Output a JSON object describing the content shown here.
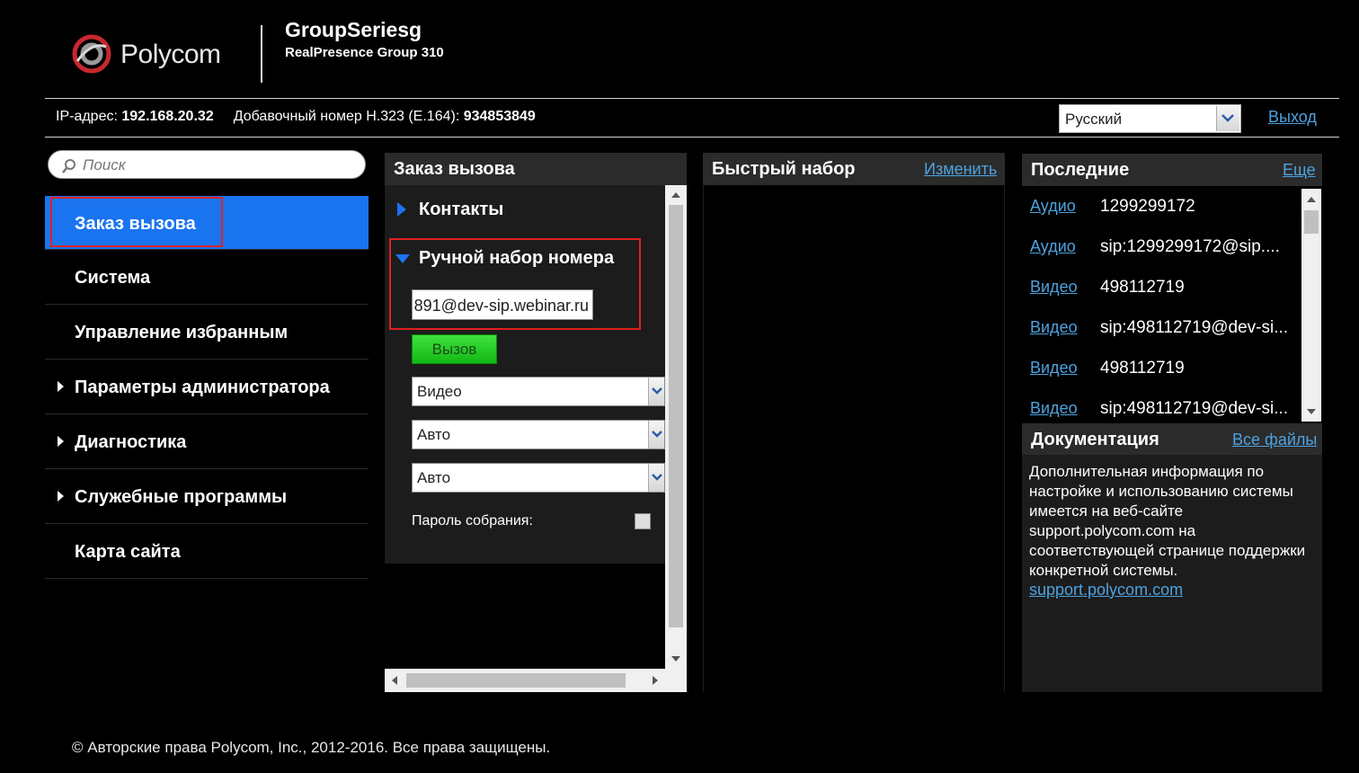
{
  "header": {
    "logo_text": "Polycom",
    "system_name": "GroupSeriesg",
    "system_model": "RealPresence Group 310"
  },
  "info_bar": {
    "ip_label": "IP-адрес:",
    "ip_value": "192.168.20.32",
    "ext_label": "Добавочный номер H.323 (E.164):",
    "ext_value": "934853849"
  },
  "language": {
    "selected": "Русский"
  },
  "logout_label": "Выход",
  "search": {
    "placeholder": "Поиск"
  },
  "nav": {
    "items": [
      {
        "label": "Заказ вызова",
        "active": true,
        "expandable": false
      },
      {
        "label": "Система",
        "active": false,
        "expandable": false
      },
      {
        "label": "Управление избранным",
        "active": false,
        "expandable": false
      },
      {
        "label": "Параметры администратора",
        "active": false,
        "expandable": true
      },
      {
        "label": "Диагностика",
        "active": false,
        "expandable": true
      },
      {
        "label": "Служебные программы",
        "active": false,
        "expandable": true
      },
      {
        "label": "Карта сайта",
        "active": false,
        "expandable": false
      }
    ]
  },
  "call_panel": {
    "title": "Заказ вызова",
    "contacts_label": "Контакты",
    "manual_dial_label": "Ручной набор номера",
    "dial_value": "891@dev-sip.webinar.ru",
    "call_button": "Вызов",
    "call_type": "Видео",
    "speed": "Авто",
    "protocol": "Авто",
    "password_label": "Пароль собрания:"
  },
  "speed_dial": {
    "title": "Быстрый набор",
    "edit_label": "Изменить"
  },
  "recent": {
    "title": "Последние",
    "more_label": "Еще",
    "items": [
      {
        "type": "Аудио",
        "number": "1299299172"
      },
      {
        "type": "Аудио",
        "number": "sip:1299299172@sip...."
      },
      {
        "type": "Видео",
        "number": "498112719"
      },
      {
        "type": "Видео",
        "number": "sip:498112719@dev-si..."
      },
      {
        "type": "Видео",
        "number": "498112719"
      },
      {
        "type": "Видео",
        "number": "sip:498112719@dev-si..."
      }
    ]
  },
  "documentation": {
    "title": "Документация",
    "all_files_label": "Все файлы",
    "text": "Дополнительная информация по настройке и использованию системы имеется на веб-сайте support.polycom.com на соответствующей странице поддержки конкретной системы.",
    "link": "support.polycom.com"
  },
  "footer": {
    "copyright": "© Авторские права Polycom, Inc., 2012-2016. Все права защищены."
  },
  "colors": {
    "accent": "#1a74f0",
    "link": "#4da3e0",
    "highlight": "#e02020",
    "call_button": "#22c822"
  }
}
